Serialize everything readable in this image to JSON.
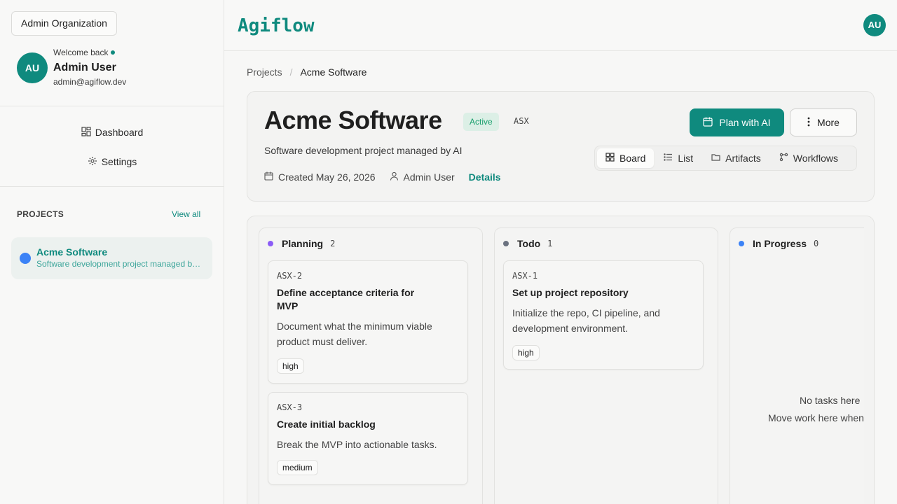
{
  "sidebar": {
    "org_button": "Admin Organization",
    "welcome": "Welcome back",
    "avatar_initials": "AU",
    "user_name": "Admin User",
    "user_email": "admin@agiflow.dev",
    "nav": {
      "dashboard": "Dashboard",
      "settings": "Settings"
    },
    "projects_label": "PROJECTS",
    "view_all": "View all",
    "projects": [
      {
        "name": "Acme Software",
        "description": "Software development project managed by AI",
        "color": "#3b82f6"
      }
    ]
  },
  "topbar": {
    "logo": "Agiflow",
    "avatar_initials": "AU"
  },
  "breadcrumb": {
    "root": "Projects",
    "separator": "/",
    "current": "Acme Software"
  },
  "project": {
    "title": "Acme Software",
    "status": "Active",
    "key": "ASX",
    "description": "Software development project managed by AI",
    "created": "Created May 26, 2026",
    "owner": "Admin User",
    "details_link": "Details",
    "actions": {
      "plan": "Plan with AI",
      "more": "More"
    },
    "tabs": {
      "board": "Board",
      "list": "List",
      "artifacts": "Artifacts",
      "workflows": "Workflows"
    }
  },
  "board": {
    "columns": [
      {
        "name": "Planning",
        "count": "2",
        "color": "#8b5cf6",
        "tasks": [
          {
            "key": "ASX-2",
            "title": "Define acceptance criteria for MVP",
            "description": "Document what the minimum viable product must deliver.",
            "priority": "high"
          },
          {
            "key": "ASX-3",
            "title": "Create initial backlog",
            "description": "Break the MVP into actionable tasks.",
            "priority": "medium"
          }
        ]
      },
      {
        "name": "Todo",
        "count": "1",
        "color": "#6b7280",
        "tasks": [
          {
            "key": "ASX-1",
            "title": "Set up project repository",
            "description": "Initialize the repo, CI pipeline, and development environment.",
            "priority": "high"
          }
        ]
      },
      {
        "name": "In Progress",
        "count": "0",
        "color": "#3b82f6",
        "empty_title": "No tasks here",
        "empty_hint": "Move work here when"
      }
    ]
  },
  "colors": {
    "accent": "#0f8a7e"
  }
}
